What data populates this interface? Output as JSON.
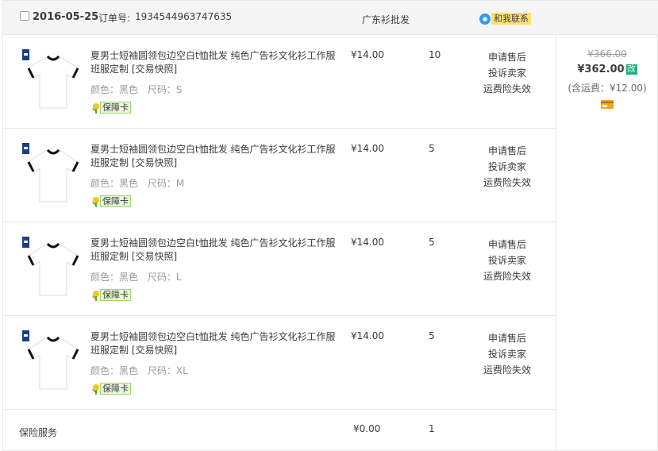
{
  "order": {
    "date": "2016-05-25",
    "order_no_label": "订单号:",
    "order_no": "1934544963747635",
    "shop_name": "广东衫批发",
    "contact_label": "和我联系"
  },
  "items": [
    {
      "title": "夏男士短袖圆领包边空白t恤批发 纯色广告衫文化衫工作服班服定制 [交易快照]",
      "color": "颜色：黑色",
      "size": "尺码：S",
      "badge": "保障卡",
      "price": "¥14.00",
      "qty": "10",
      "actions": [
        "申请售后",
        "投诉卖家",
        "运费险失效"
      ]
    },
    {
      "title": "夏男士短袖圆领包边空白t恤批发 纯色广告衫文化衫工作服班服定制 [交易快照]",
      "color": "颜色：黑色",
      "size": "尺码：M",
      "badge": "保障卡",
      "price": "¥14.00",
      "qty": "5",
      "actions": [
        "申请售后",
        "投诉卖家",
        "运费险失效"
      ]
    },
    {
      "title": "夏男士短袖圆领包边空白t恤批发 纯色广告衫文化衫工作服班服定制 [交易快照]",
      "color": "颜色：黑色",
      "size": "尺码：L",
      "badge": "保障卡",
      "price": "¥14.00",
      "qty": "5",
      "actions": [
        "申请售后",
        "投诉卖家",
        "运费险失效"
      ]
    },
    {
      "title": "夏男士短袖圆领包边空白t恤批发 纯色广告衫文化衫工作服班服定制 [交易快照]",
      "color": "颜色：黑色",
      "size": "尺码：XL",
      "badge": "保障卡",
      "price": "¥14.00",
      "qty": "5",
      "actions": [
        "申请售后",
        "投诉卖家",
        "运费险失效"
      ]
    }
  ],
  "service": {
    "label": "保险服务",
    "price": "¥0.00",
    "qty": "1"
  },
  "totals": {
    "original": "¥366.00",
    "paid": "¥362.00",
    "edit_label": "改",
    "shipping": "(含运费：¥12.00)"
  },
  "icons": {
    "checkbox": "checkbox-icon",
    "contact": "chat-bubble-icon",
    "badge": "flower-badge-icon",
    "card": "credit-card-icon"
  },
  "colors": {
    "header_bg": "#f5f5f5",
    "border": "#e8e8e8",
    "muted_text": "#9c9c9c",
    "contact_bg": "#ffe36a",
    "edit_badge": "#28b07e"
  }
}
